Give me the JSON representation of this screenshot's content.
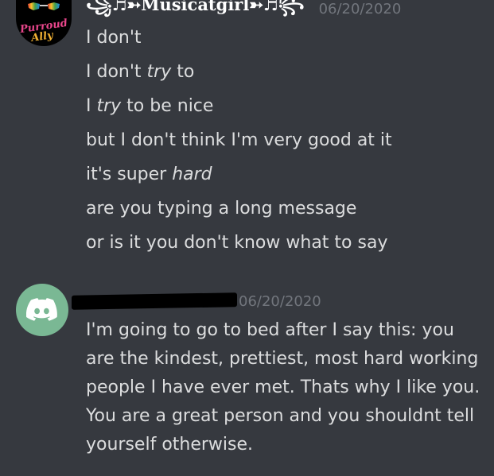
{
  "messages": [
    {
      "author": "꧁♬➳Musicatgirl➳♬꧂",
      "avatar_text_1": "Purroud",
      "avatar_text_2": "Ally",
      "timestamp": "06/20/2020",
      "lines": [
        [
          "I don't"
        ],
        [
          "I don't ",
          {
            "em": "try"
          },
          " to"
        ],
        [
          "I ",
          {
            "em": "try"
          },
          " to be nice"
        ],
        [
          "but I don't think I'm very good at it"
        ],
        [
          "it's super ",
          {
            "em": "hard"
          }
        ],
        [
          "are you typing a long message"
        ],
        [
          "or is it you don't know what to say"
        ]
      ]
    },
    {
      "author_redacted": true,
      "avatar_icon": "discord-logo-icon",
      "timestamp": "06/20/2020",
      "text": "I'm going to go to bed after I say this: you are the kindest, prettiest, most hard working people I have ever met. Thats why I like you. You are a great person and you shouldnt tell yourself otherwise."
    }
  ],
  "colors": {
    "background": "#36393f",
    "text": "#dcddde",
    "timestamp": "#72767d",
    "username": "#ffffff",
    "avatar_green": "#7ab894"
  }
}
